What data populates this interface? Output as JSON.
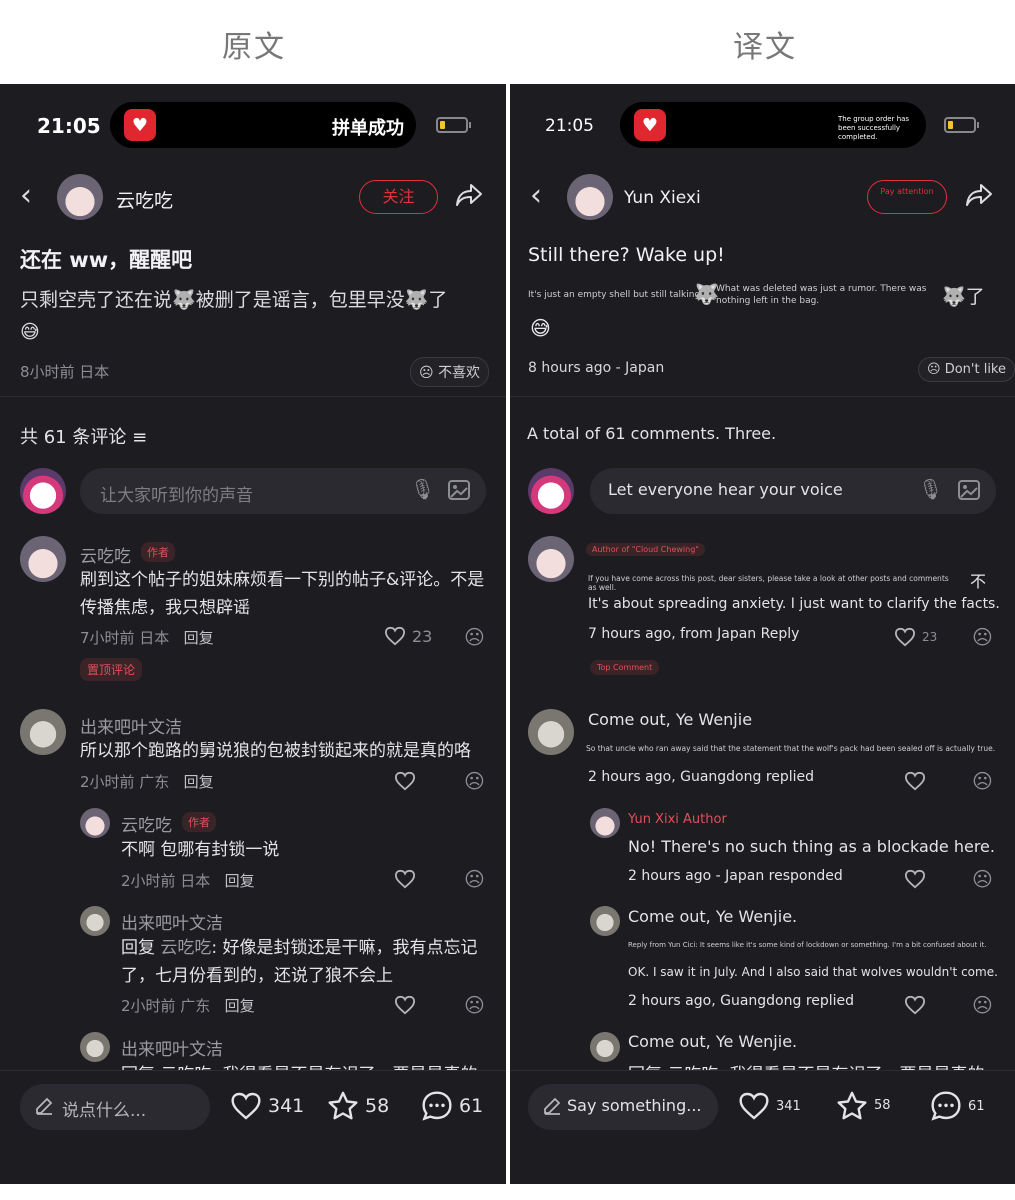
{
  "labels": {
    "original": "原文",
    "translated": "译文"
  },
  "left": {
    "status": {
      "time": "21:05",
      "island_text": "拼单成功"
    },
    "nav": {
      "username": "云吃吃",
      "follow": "关注"
    },
    "post": {
      "title": "还在 ww，醒醒吧",
      "body_1": "只剩空壳了还在说",
      "body_2": "被删了是谣言，包里早没",
      "body_3": "了",
      "emoji": "😅",
      "meta": "8小时前 日本",
      "dislike": "不喜欢"
    },
    "comments_header": {
      "count": "共 61 条评论"
    },
    "input": {
      "placeholder": "让大家听到你的声音"
    },
    "comments": [
      {
        "name": "云吃吃",
        "badge": "作者",
        "text": "刷到这个帖子的姐妹麻烦看一下别的帖子&评论。不是传播焦虑，我只想辟谣",
        "time": "7小时前 日本",
        "reply": "回复",
        "likes": "23",
        "pin": "置顶评论"
      },
      {
        "name": "出来吧叶文洁",
        "text": "所以那个跑路的舅说狼的包被封锁起来的就是真的咯",
        "time": "2小时前 广东",
        "reply": "回复"
      }
    ],
    "replies": [
      {
        "name": "云吃吃",
        "badge": "作者",
        "text": "不啊 包哪有封锁一说",
        "time": "2小时前 日本",
        "reply": "回复"
      },
      {
        "name": "出来吧叶文洁",
        "prefix": "回复 ",
        "mention": "云吃吃",
        "text": ": 好像是封锁还是干嘛，我有点忘记了，七月份看到的，还说了狼不会上",
        "time": "2小时前 广东",
        "reply": "回复"
      },
      {
        "name": "出来吧叶文洁",
        "text": "回复 云吃吃: 我得看是不是有误了，要是是真的"
      }
    ],
    "bottom": {
      "say": "说点什么...",
      "likes": "341",
      "stars": "58",
      "comments": "61"
    }
  },
  "right": {
    "status": {
      "time": "21:05",
      "island_text": "The group order has been successfully completed."
    },
    "nav": {
      "username": "Yun Xiexi",
      "follow": "Pay attention"
    },
    "post": {
      "title": "Still there? Wake up!",
      "body_1": "It's just an empty shell but still talking.",
      "body_2": "What was deleted was just a rumor. There was nothing left in the bag.",
      "body_3": "了",
      "emoji": "😅",
      "meta": "8 hours ago - Japan",
      "dislike": "Don't like"
    },
    "comments_header": {
      "count": "A total of 61 comments. Three."
    },
    "input": {
      "placeholder": "Let everyone hear your voice"
    },
    "comments": [
      {
        "badge": "Author of \"Cloud Chewing\"",
        "small_text": "If you have come across this post, dear sisters, please take a look at other posts and comments as well.",
        "glyph": "不",
        "text": "It's about spreading anxiety. I just want to clarify the facts.",
        "time": "7 hours ago, from Japan  Reply",
        "likes": "23",
        "pin": "Top Comment"
      },
      {
        "name": "Come out, Ye Wenjie",
        "small_text": "So that uncle who ran away said that the statement that the wolf's pack had been sealed off is actually true.",
        "time": "2 hours ago, Guangdong replied"
      }
    ],
    "replies": [
      {
        "name": "Yun Xixi Author",
        "text": "No! There's no such thing as a blockade here.",
        "time": "2 hours ago - Japan responded"
      },
      {
        "name": "Come out, Ye Wenjie.",
        "small_text": "Reply from Yun Cici: It seems like it's some kind of lockdown or something. I'm a bit confused about it.",
        "text": "OK. I saw it in July. And I also said that wolves wouldn't come.",
        "time": "2 hours ago, Guangdong replied"
      },
      {
        "name": "Come out, Ye Wenjie.",
        "text": "回复 云吃吃: 我得看是不是有误了，要是是真的"
      }
    ],
    "bottom": {
      "say": "Say something...",
      "likes": "341",
      "stars": "58",
      "comments": "61"
    }
  }
}
